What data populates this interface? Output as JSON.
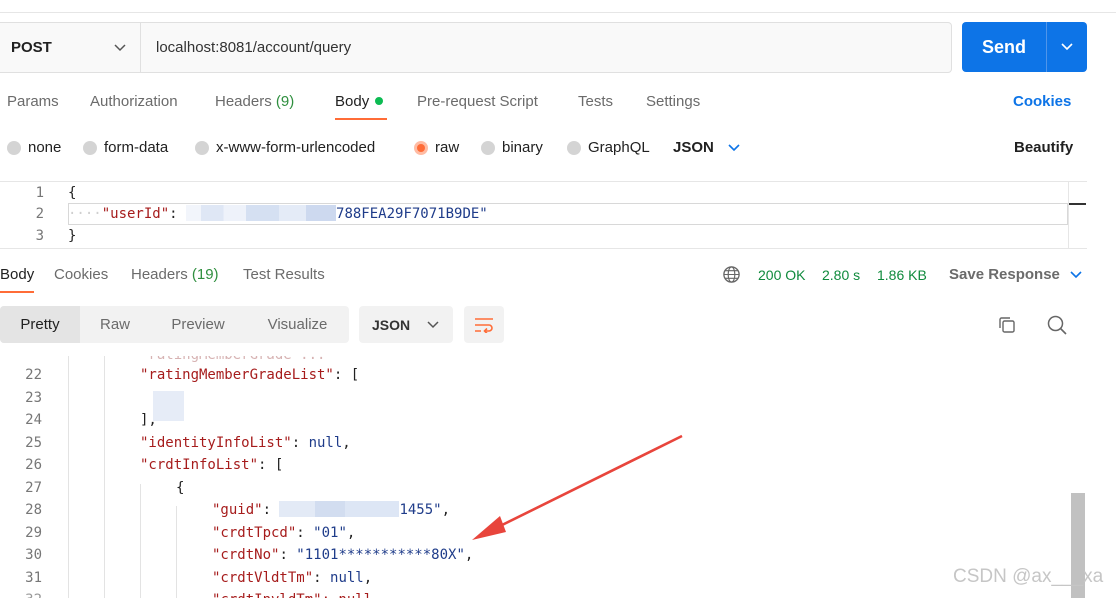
{
  "request": {
    "method": "POST",
    "url": "localhost:8081/account/query",
    "send_label": "Send"
  },
  "request_tabs": {
    "params": "Params",
    "authorization": "Authorization",
    "headers": "Headers",
    "headers_count": "(9)",
    "body": "Body",
    "prerequest": "Pre-request Script",
    "tests": "Tests",
    "settings": "Settings",
    "cookies": "Cookies"
  },
  "body_types": {
    "none": "none",
    "form_data": "form-data",
    "urlencoded": "x-www-form-urlencoded",
    "raw": "raw",
    "binary": "binary",
    "graphql": "GraphQL",
    "language": "JSON",
    "beautify": "Beautify"
  },
  "request_body": [
    {
      "num": "1",
      "text": "{"
    },
    {
      "num": "2",
      "key": "\"userId\"",
      "colon": ": ",
      "value_suffix": "788FEA29F7071B9DE\""
    },
    {
      "num": "3",
      "text": "}"
    }
  ],
  "response_tabs": {
    "body": "Body",
    "cookies": "Cookies",
    "headers": "Headers",
    "headers_count": "(19)",
    "test_results": "Test Results"
  },
  "response_status": {
    "code": "200 OK",
    "time": "2.80 s",
    "size": "1.86 KB",
    "save": "Save Response"
  },
  "response_view": {
    "pretty": "Pretty",
    "raw": "Raw",
    "preview": "Preview",
    "visualize": "Visualize",
    "format": "JSON"
  },
  "response_body": [
    {
      "num": "22",
      "key": "\"ratingMemberGradeList\"",
      "tail": ": ["
    },
    {
      "num": "23"
    },
    {
      "num": "24",
      "text": "],"
    },
    {
      "num": "25",
      "key": "\"identityInfoList\"",
      "tail_kw": "null",
      "tail": ","
    },
    {
      "num": "26",
      "key": "\"crdtInfoList\"",
      "tail": ": ["
    },
    {
      "num": "27",
      "text": "{"
    },
    {
      "num": "28",
      "key": "\"guid\"",
      "value": "1455\"",
      "tail": ","
    },
    {
      "num": "29",
      "key": "\"crdtTpcd\"",
      "value": "\"01\"",
      "tail": ","
    },
    {
      "num": "30",
      "key": "\"crdtNo\"",
      "value": "\"1101***********80X\"",
      "tail": ","
    },
    {
      "num": "31",
      "key": "\"crdtVldtTm\"",
      "tail_kw": "null",
      "tail": ","
    }
  ],
  "watermark": "CSDN @ax___xa"
}
